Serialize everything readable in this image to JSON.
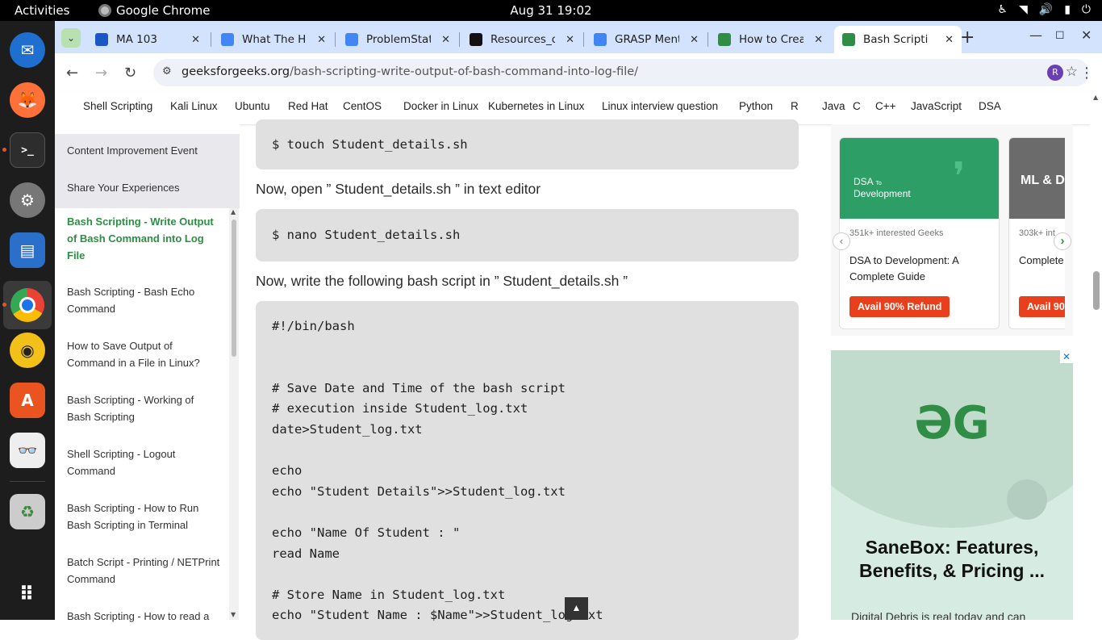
{
  "system": {
    "activities": "Activities",
    "app": "Google Chrome",
    "clock": "Aug 31  19:02"
  },
  "tabs": [
    {
      "title": "MA 103",
      "icon": "profile-icon",
      "color": "#1a56c6"
    },
    {
      "title": "What The Ha",
      "icon": "docs-icon",
      "color": "#4285f4"
    },
    {
      "title": "ProblemStat",
      "icon": "docs-icon",
      "color": "#4285f4"
    },
    {
      "title": "Resources_o",
      "icon": "github-icon",
      "color": "#111111"
    },
    {
      "title": "GRASP Ment",
      "icon": "docs-icon",
      "color": "#4285f4"
    },
    {
      "title": "How to Creat",
      "icon": "gfg-icon",
      "color": "#2f8d46"
    },
    {
      "title": "Bash Scriptin",
      "icon": "gfg-icon",
      "color": "#2f8d46"
    }
  ],
  "address": {
    "domain": "geeksforgeeks.org",
    "path": "/bash-scripting-write-output-of-bash-command-into-log-file/",
    "avatar": "R"
  },
  "nav": [
    "Shell Scripting",
    "Kali Linux",
    "Ubuntu",
    "Red Hat",
    "CentOS",
    "Docker in Linux",
    "Kubernetes in Linux",
    "Linux interview question",
    "Python",
    "R",
    "Java",
    "C",
    "C++",
    "JavaScript",
    "DSA"
  ],
  "sidebar": {
    "headers": [
      "Content Improvement Event",
      "Share Your Experiences"
    ],
    "items": [
      "Bash Scripting - Write Output of Bash Command into Log File",
      "Bash Scripting - Bash Echo Command",
      "How to Save Output of Command in a File in Linux?",
      "Bash Scripting - Working of Bash Scripting",
      "Shell Scripting - Logout Command",
      "Bash Scripting - How to Run Bash Scripting in Terminal",
      "Batch Script - Printing / NETPrint Command",
      "Bash Scripting - How to read a"
    ]
  },
  "article": {
    "cmd1": "$ touch Student_details.sh",
    "p1": "Now, open ” Student_details.sh ” in text editor",
    "cmd2": "$ nano Student_details.sh",
    "p2": "Now, write the following bash script in ” Student_details.sh ”",
    "code": [
      "#!/bin/bash",
      "",
      "",
      "# Save Date and Time of the bash script",
      "# execution inside Student_log.txt",
      "date>Student_log.txt",
      "",
      "echo",
      "echo \"Student Details\">>Student_log.txt",
      "",
      "echo \"Name Of Student : \"",
      "read Name",
      "",
      "# Store Name in Student_log.txt",
      "echo \"Student Name : $Name\">>Student_log.txt"
    ]
  },
  "courses": [
    {
      "banner_small": "DSA",
      "banner_to": "To",
      "banner_big": "Development",
      "interest": "351k+ interested Geeks",
      "title": "DSA to Development: A Complete Guide",
      "button": "Avail 90% Refund",
      "bg": "#2e9e67"
    },
    {
      "banner": "ML & D",
      "interest": "303k+ int",
      "title": "Complete Data Scien",
      "button": "Avail 90",
      "bg": "#6b6b6b"
    }
  ],
  "ad": {
    "headline": "SaneBox: Features, Benefits, & Pricing ...",
    "snippet": "Digital Debris is real today and can",
    "logo_color": "#2f8d46"
  },
  "colors": {
    "tabbar": "#d3e3fd",
    "gfg_green": "#2f8d46",
    "code_bg": "#e0e0e0",
    "refund": "#e8401c"
  }
}
